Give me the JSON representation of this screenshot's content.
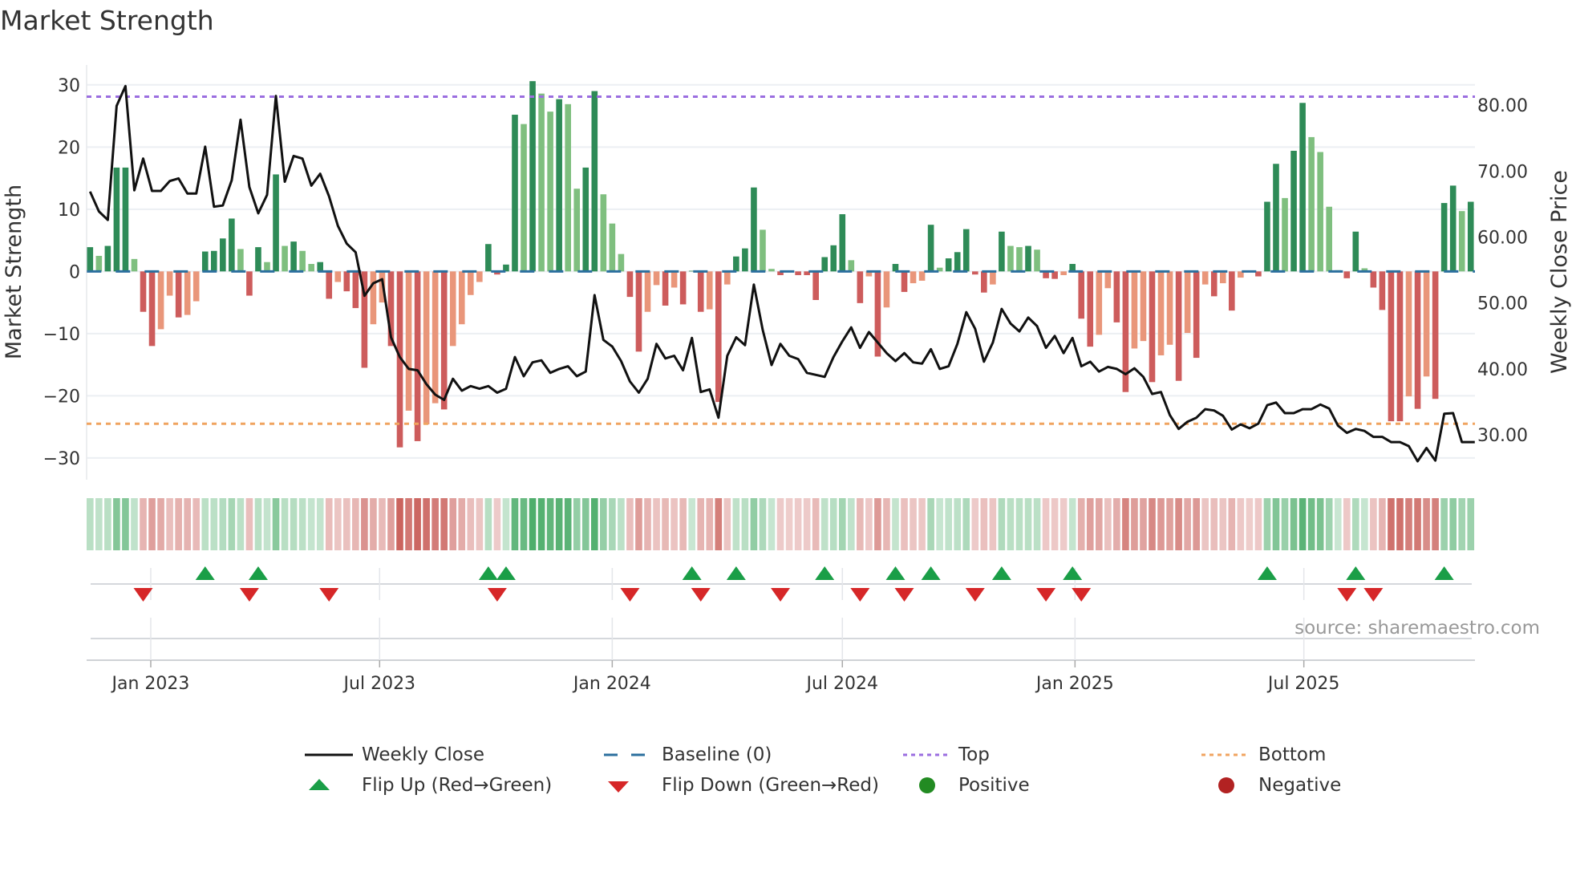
{
  "title": "Market Strength",
  "source": "source: sharemaestro.com",
  "legend": {
    "weekly_close": "Weekly Close",
    "baseline": "Baseline (0)",
    "top": "Top",
    "bottom": "Bottom",
    "flip_up": "Flip Up (Red→Green)",
    "flip_down": "Flip Down (Green→Red)",
    "positive": "Positive",
    "negative": "Negative"
  },
  "colors": {
    "bar_pos_strong": "#2e8b57",
    "bar_pos_weak": "#7fbf7f",
    "bar_neg_strong": "#cd5c5c",
    "bar_neg_weak": "#e9967a",
    "close_line": "#111111",
    "baseline": "#2b6f9e",
    "top": "#9b6ee0",
    "bottom": "#f0a460",
    "flip_up": "#1a9e47",
    "flip_down": "#d62728",
    "positive": "#228b22",
    "negative": "#b22222",
    "strip_pos": "#3ca55c",
    "strip_neg": "#c24a44",
    "grid": "#eceff3"
  },
  "chart_data": {
    "type": "bar+line",
    "title": "Market Strength",
    "ylabel": "Market Strength",
    "y2label": "Weekly Close Price",
    "ylim": [
      -33.5,
      33.2
    ],
    "y2lim": [
      23.2,
      86.1
    ],
    "grid": true,
    "legend_position": "bottom",
    "start_week": "2022-11-14",
    "interval_days": 7,
    "top_level": 28.1,
    "bottom_level": -24.5,
    "baseline": 0,
    "yticks": [
      {
        "value": 30,
        "label": "30"
      },
      {
        "value": 20,
        "label": "20"
      },
      {
        "value": 10,
        "label": "10"
      },
      {
        "value": 0,
        "label": "0"
      },
      {
        "value": -10,
        "label": "−10"
      },
      {
        "value": -20,
        "label": "−20"
      },
      {
        "value": -30,
        "label": "−30"
      }
    ],
    "y2ticks": [
      {
        "value": 80,
        "label": "80.00"
      },
      {
        "value": 70,
        "label": "70.00"
      },
      {
        "value": 60,
        "label": "60.00"
      },
      {
        "value": 50,
        "label": "50.00"
      },
      {
        "value": 40,
        "label": "40.00"
      },
      {
        "value": 30,
        "label": "30.00"
      }
    ],
    "xticks": [
      {
        "date": "2023-01-01",
        "label": "Jan 2023"
      },
      {
        "date": "2023-07-01",
        "label": "Jul 2023"
      },
      {
        "date": "2024-01-01",
        "label": "Jan 2024"
      },
      {
        "date": "2024-07-01",
        "label": "Jul 2024"
      },
      {
        "date": "2025-01-01",
        "label": "Jan 2025"
      },
      {
        "date": "2025-07-01",
        "label": "Jul 2025"
      }
    ],
    "strength": [
      3.9,
      2.5,
      4.1,
      16.7,
      16.7,
      2.0,
      -6.5,
      -12.0,
      -9.3,
      -3.9,
      -7.4,
      -7.0,
      -4.8,
      3.2,
      3.3,
      5.3,
      8.5,
      3.6,
      -3.9,
      3.9,
      1.5,
      15.6,
      4.1,
      4.8,
      3.3,
      1.2,
      1.5,
      -4.4,
      -1.7,
      -3.2,
      -5.9,
      -15.5,
      -8.5,
      -5.0,
      -12.0,
      -28.3,
      -22.4,
      -27.3,
      -24.6,
      -21.2,
      -22.2,
      -12.0,
      -8.5,
      -3.8,
      -1.7,
      4.4,
      -0.5,
      1.1,
      25.2,
      23.7,
      30.6,
      28.6,
      25.7,
      27.7,
      26.9,
      13.3,
      16.7,
      29.0,
      12.4,
      7.7,
      2.8,
      -4.1,
      -12.9,
      -6.5,
      -2.2,
      -5.5,
      -2.6,
      -5.3,
      0.1,
      -6.5,
      -6.1,
      -21.0,
      -2.1,
      2.4,
      3.7,
      13.5,
      6.7,
      0.4,
      -0.6,
      -0.1,
      -0.6,
      -0.6,
      -4.6,
      2.3,
      4.2,
      9.2,
      1.8,
      -5.1,
      -0.8,
      -13.7,
      -5.8,
      1.2,
      -3.3,
      -1.9,
      -1.5,
      7.5,
      0.6,
      2.1,
      3.1,
      6.8,
      -0.5,
      -3.4,
      -2.1,
      6.4,
      4.1,
      3.9,
      4.1,
      3.5,
      -1.1,
      -1.2,
      -0.6,
      1.2,
      -7.6,
      -12.1,
      -10.2,
      -2.7,
      -8.2,
      -19.4,
      -12.4,
      -11.2,
      -17.8,
      -13.5,
      -11.8,
      -17.6,
      -9.9,
      -13.9,
      -2.1,
      -4.0,
      -1.9,
      -6.3,
      -1.0,
      -0.1,
      -0.8,
      11.2,
      17.3,
      11.8,
      19.4,
      27.1,
      21.6,
      19.2,
      10.4,
      0.2,
      -1.1,
      6.4,
      0.5,
      -2.6,
      -6.2,
      -24.1,
      -24.1,
      -20.1,
      -22.1,
      -16.9,
      -20.5,
      11.0,
      13.8,
      9.7,
      11.2
    ],
    "close": [
      66.9,
      63.9,
      62.6,
      79.9,
      82.9,
      67.1,
      71.9,
      67.0,
      67.0,
      68.5,
      68.9,
      66.6,
      66.6,
      73.7,
      64.6,
      64.8,
      68.6,
      77.8,
      67.6,
      63.6,
      66.4,
      81.4,
      68.4,
      72.3,
      71.9,
      67.8,
      69.6,
      66.2,
      61.7,
      59.0,
      57.7,
      51.1,
      53.0,
      53.6,
      44.8,
      41.8,
      40.0,
      39.8,
      37.7,
      36.1,
      35.3,
      38.5,
      36.7,
      37.4,
      37.0,
      37.4,
      36.4,
      37.0,
      41.8,
      38.9,
      41.0,
      41.3,
      39.4,
      40.0,
      40.4,
      38.9,
      39.6,
      51.2,
      44.4,
      43.4,
      41.2,
      38.1,
      36.4,
      38.5,
      43.8,
      41.6,
      42.0,
      39.8,
      44.7,
      36.5,
      36.9,
      32.6,
      42.0,
      44.8,
      43.6,
      52.8,
      45.9,
      40.6,
      43.8,
      42.0,
      41.5,
      39.4,
      39.1,
      38.8,
      41.8,
      44.2,
      46.3,
      43.2,
      45.6,
      44.0,
      42.4,
      41.2,
      42.4,
      41.0,
      40.8,
      43.0,
      40.0,
      40.4,
      43.8,
      48.6,
      46.1,
      41.1,
      44.0,
      49.1,
      46.9,
      45.7,
      47.8,
      46.5,
      43.2,
      45.0,
      42.4,
      44.7,
      40.4,
      41.1,
      39.6,
      40.3,
      40.0,
      39.2,
      40.1,
      38.8,
      36.2,
      36.5,
      33.0,
      30.9,
      32.0,
      32.6,
      33.9,
      33.7,
      32.9,
      30.8,
      31.6,
      31.0,
      31.7,
      34.5,
      34.9,
      33.3,
      33.3,
      33.9,
      33.9,
      34.6,
      34.0,
      31.4,
      30.3,
      30.9,
      30.6,
      29.7,
      29.7,
      28.9,
      28.9,
      28.3,
      26.0,
      28.0,
      26.1,
      33.2,
      33.3,
      28.9,
      28.9
    ]
  }
}
